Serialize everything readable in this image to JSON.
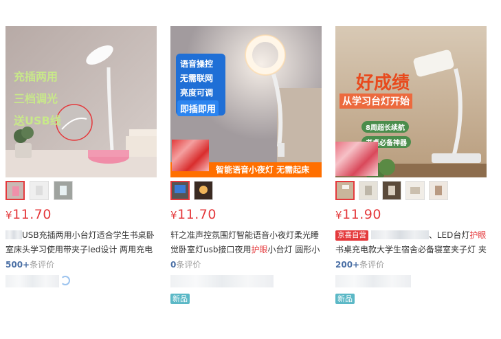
{
  "colors": {
    "price": "#e4393c",
    "review_count": "#4a6fa5",
    "tag_new": "#5bb8c6",
    "tag_jd": "#e4393c"
  },
  "products": [
    {
      "image_texts": [
        "充插两用",
        "三档调光",
        "送USB线"
      ],
      "price_currency": "¥",
      "price": "11.70",
      "title_pre": "",
      "title_text": "USB充插两用小台灯适合学生书桌卧室床头学习使用带夹子led设计 两用充电",
      "title_hl": "",
      "title_post": "",
      "review_count": "500+",
      "review_label": "条评价",
      "new_tag": ""
    },
    {
      "image_texts": [
        "语音操控",
        "无需联网",
        "亮度可调",
        "即插即用",
        "智能语音小夜灯 无需起床"
      ],
      "price_currency": "¥",
      "price": "11.70",
      "title_pre": "",
      "title_text": "轩之准声控氛围灯智能语音小夜灯柔光睡觉卧室灯usb接口夜用",
      "title_hl": "护眼",
      "title_post": "小台灯 圆形小",
      "review_count": "0",
      "review_label": "条评价",
      "new_tag": "新品"
    },
    {
      "image_texts": [
        "好成绩",
        "从学习台灯开始",
        "8周超长续航",
        "书桌必备神器"
      ],
      "price_currency": "¥",
      "price": "11.90",
      "jd_tag": "京喜自营",
      "title_pre": "、LED台灯",
      "title_hl": "护眼",
      "title_post": "书桌充电款大学生宿舍必备寝室夹子灯 夹",
      "title_text": "",
      "review_count": "200+",
      "review_label": "条评价",
      "new_tag": "新品"
    }
  ]
}
